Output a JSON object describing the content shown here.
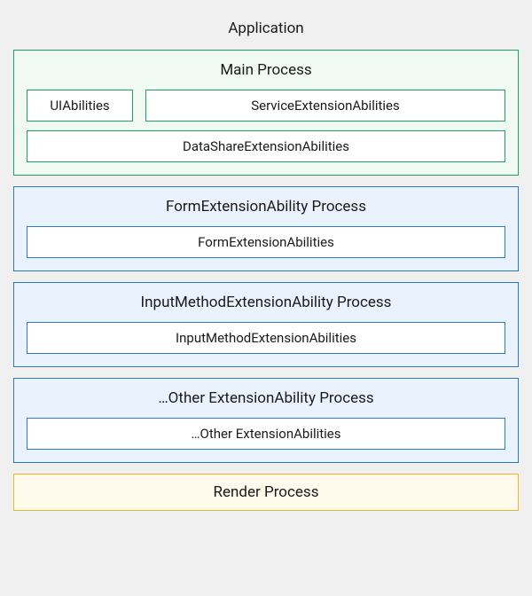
{
  "app_label": "Application",
  "main": {
    "title": "Main Process",
    "ui": "UIAbilities",
    "service": "ServiceExtensionAbilities",
    "datashare": "DataShareExtensionAbilities"
  },
  "form": {
    "title": "FormExtensionAbility Process",
    "item": "FormExtensionAbilities"
  },
  "ime": {
    "title": "InputMethodExtensionAbility Process",
    "item": "InputMethodExtensionAbilities"
  },
  "other": {
    "title": "…Other ExtensionAbility Process",
    "item": "…Other ExtensionAbilities"
  },
  "render": {
    "title": "Render Process"
  }
}
